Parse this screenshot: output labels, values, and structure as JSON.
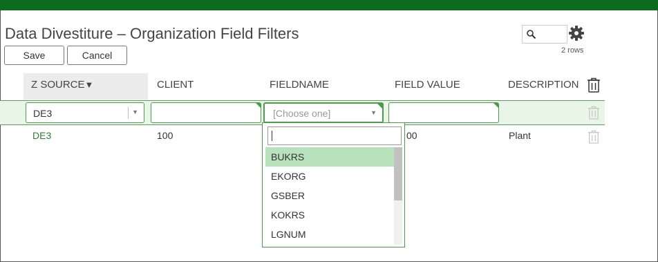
{
  "page": {
    "title": "Data Divestiture – Organization Field Filters",
    "rows_count": "2 rows",
    "search": {
      "placeholder": ""
    }
  },
  "toolbar": {
    "save_label": "Save",
    "cancel_label": "Cancel"
  },
  "columns": [
    {
      "label": "Z SOURCE",
      "sort": "▼"
    },
    {
      "label": "CLIENT"
    },
    {
      "label": "FIELDNAME"
    },
    {
      "label": "FIELD VALUE"
    },
    {
      "label": "DESCRIPTION"
    }
  ],
  "edit_row": {
    "z_source": "DE3",
    "client": "",
    "fieldname_placeholder": "[Choose one]",
    "field_value": ""
  },
  "rows": [
    {
      "z_source": "DE3",
      "client": "100",
      "field_value_partial": "00",
      "description": "Plant"
    }
  ],
  "dropdown": {
    "search_value": "",
    "items": [
      "BUKRS",
      "EKORG",
      "GSBER",
      "KOKRS",
      "LGNUM"
    ],
    "selected": "BUKRS"
  },
  "colors": {
    "header_bar": "#0b6b1e",
    "accent_green": "#4b9b4b",
    "link_green": "#2e7d32",
    "selected_bg": "#b7e2bb",
    "edit_row_bg": "#e9f5e6"
  },
  "icons": [
    "search-icon",
    "gear-icon",
    "trash-icon",
    "caret-down-icon"
  ]
}
